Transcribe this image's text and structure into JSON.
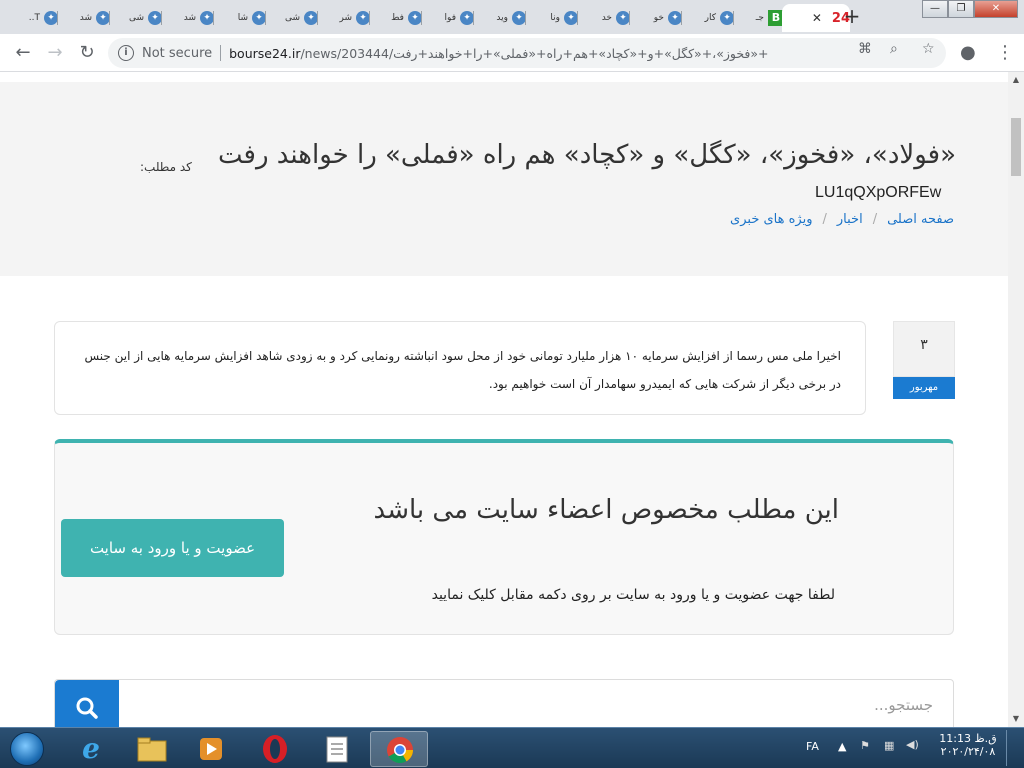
{
  "browser": {
    "tabs": [
      {
        "label": "T.."
      },
      {
        "label": "شد"
      },
      {
        "label": "شی"
      },
      {
        "label": "شد"
      },
      {
        "label": "شا"
      },
      {
        "label": "شی"
      },
      {
        "label": "شر"
      },
      {
        "label": "فط"
      },
      {
        "label": "فوا"
      },
      {
        "label": "وید"
      },
      {
        "label": "ونا"
      },
      {
        "label": "خد"
      },
      {
        "label": "خو"
      },
      {
        "label": "کار"
      },
      {
        "label": "جـ"
      }
    ],
    "active_tab": {
      "favicon_text": "24",
      "close": "✕"
    },
    "newtab": "+",
    "window_controls": {
      "minimize": "—",
      "restore": "❐",
      "close": "✕"
    },
    "omnibox": {
      "security_label": "Not secure",
      "url_host": "bourse24.ir",
      "url_path": "/news/203444/فولاد»،+«فخوز»،+«کگل»+و+«کچاد»+هم+راه+«فملی»+را+خواهند+رفت»"
    }
  },
  "page": {
    "title": "«فولاد»، «فخوز»، «کگل» و «کچاد» هم راه «فملی» را خواهند رفت",
    "code_label": "کد مطلب:",
    "code_value": "LU1qQXpORFEw",
    "breadcrumb": [
      {
        "label": "صفحه اصلی"
      },
      {
        "label": "اخبار"
      },
      {
        "label": "ویژه های خبری"
      }
    ],
    "date": {
      "day": "۳",
      "month": "مهر‌بور"
    },
    "summary": "اخیرا ملی مس رسما از افزایش سرمایه ۱۰ هزار ملیارد تومانی خود از محل سود انباشته رونمایی کرد و به زودی شاهد افزایش سرمایه هایی از این جنس در برخی دیگر از شرکت هایی که ایمیدرو سهامدار آن است خواهیم بود.",
    "members": {
      "headline": "این مطلب مخصوص اعضاء سایت می باشد",
      "hint": "لطفا جهت عضویت و یا ورود به سایت بر روی دکمه مقابل کلیک نمایید",
      "button": "عضویت و یا ورود به سایت"
    },
    "search": {
      "placeholder": "جستجو..."
    }
  },
  "taskbar": {
    "language": "FA",
    "time": "11:13 ق.ظ",
    "date": "۲۰۲۰/۲۴/۰۸"
  },
  "colors": {
    "teal": "#3fb3b0",
    "blue": "#1b7bd1",
    "hero_bg": "#f4f4f4"
  }
}
